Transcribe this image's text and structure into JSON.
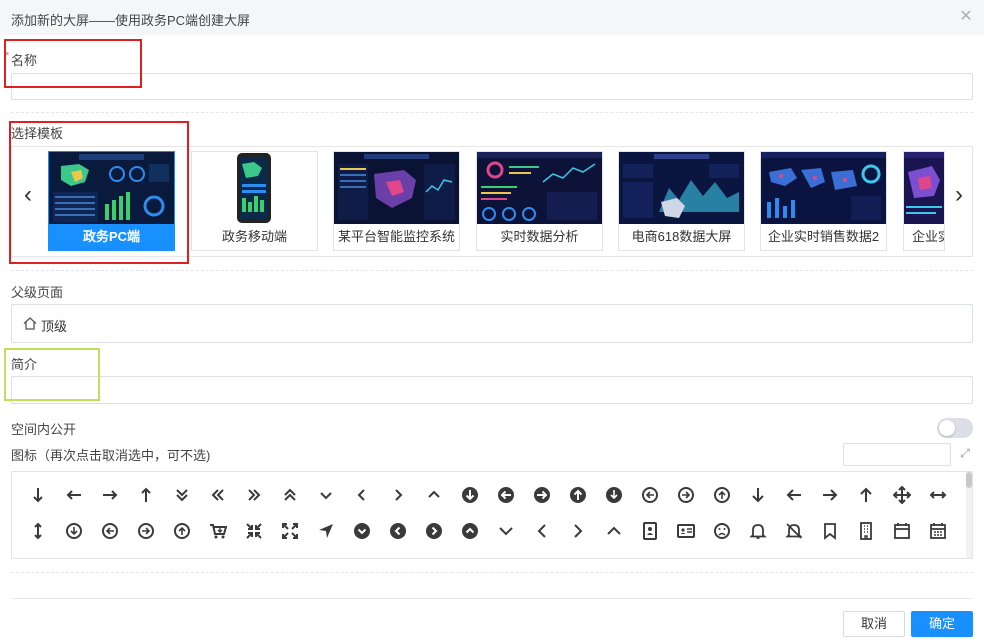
{
  "dialog": {
    "title": "添加新的大屏——使用政务PC端创建大屏",
    "close_icon": "close-icon"
  },
  "form": {
    "name": {
      "label": "名称",
      "required_mark": "*",
      "value": ""
    },
    "template": {
      "label": "选择模板"
    },
    "parent": {
      "label": "父级页面",
      "value": "顶级",
      "icon": "home-icon"
    },
    "intro": {
      "label": "简介",
      "value": ""
    },
    "public": {
      "label": "空间内公开",
      "enabled": false
    },
    "icon": {
      "label": "图标（再次点击取消选中，可不选)",
      "search_value": ""
    }
  },
  "templates": [
    {
      "label": "政务PC端",
      "selected": true,
      "theme": "dark"
    },
    {
      "label": "政务移动端",
      "selected": false,
      "theme": "mobile"
    },
    {
      "label": "某平台智能监控系统",
      "selected": false,
      "theme": "dark"
    },
    {
      "label": "实时数据分析",
      "selected": false,
      "theme": "dark"
    },
    {
      "label": "电商618数据大屏",
      "selected": false,
      "theme": "dark"
    },
    {
      "label": "企业实时销售数据2",
      "selected": false,
      "theme": "dark"
    },
    {
      "label": "企业实",
      "selected": false,
      "theme": "dark"
    }
  ],
  "icons_row1": [
    "long-arrow-down",
    "long-arrow-left",
    "long-arrow-right",
    "long-arrow-up",
    "angle-double-down",
    "angle-double-left",
    "angle-double-right",
    "angle-double-up",
    "angle-down",
    "angle-left",
    "angle-right",
    "angle-up",
    "arrow-circle-down",
    "arrow-circle-left",
    "arrow-circle-right",
    "arrow-circle-up",
    "arrow-circle-o-down",
    "arrow-circle-o-left",
    "arrow-circle-o-right",
    "arrow-circle-o-up",
    "arrow-down",
    "arrow-left",
    "arrow-right",
    "arrow-up",
    "arrows-alt",
    "arrows-h"
  ],
  "icons_row2": [
    "arrows-v",
    "arrow-circle-o-down-2",
    "arrow-circle-o-left-2",
    "arrow-circle-o-right-2",
    "arrow-circle-o-up-2",
    "cart-arrow-down",
    "compress",
    "expand",
    "location-arrow",
    "chevron-circle-down",
    "chevron-circle-left",
    "chevron-circle-right",
    "chevron-circle-up",
    "chevron-down",
    "chevron-left",
    "chevron-right",
    "chevron-up",
    "address-book",
    "address-card",
    "frown",
    "bell",
    "bell-slash",
    "bookmark",
    "building",
    "calendar",
    "calendar-grid"
  ],
  "footer": {
    "cancel_label": "取消",
    "ok_label": "确定"
  },
  "colors": {
    "primary": "#1890ff",
    "highlight_red": "#e02020",
    "highlight_green": "#bfe05a"
  }
}
